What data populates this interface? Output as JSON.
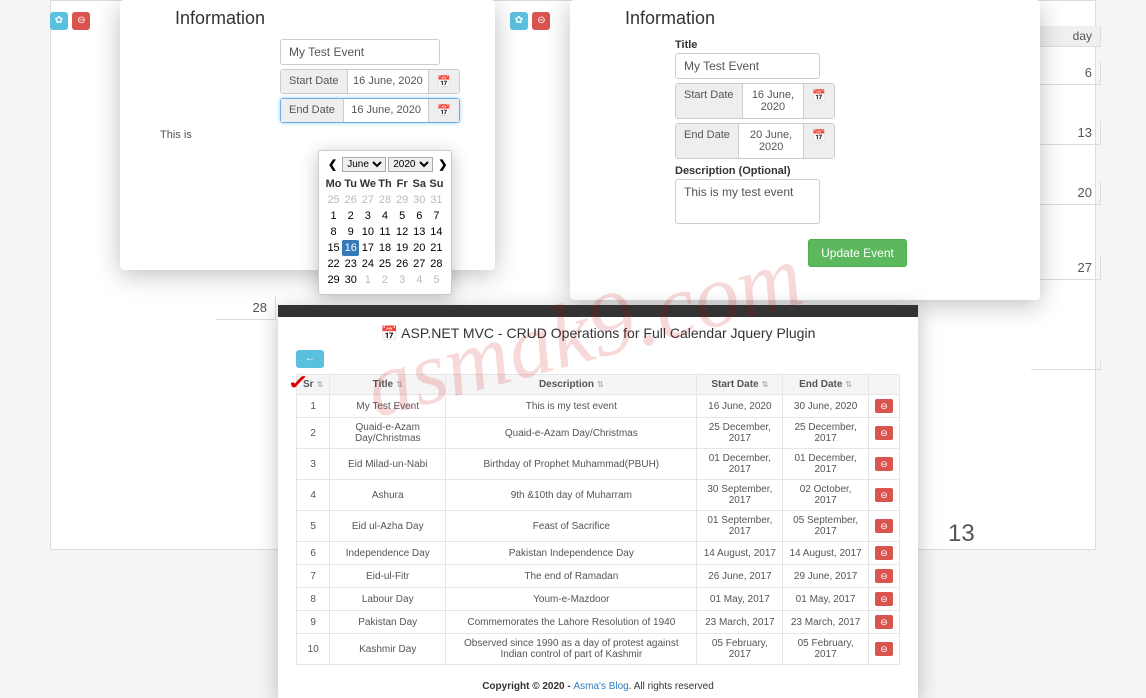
{
  "addModal": {
    "heading": "Information",
    "titleValue": "My Test Event",
    "startLabel": "Start Date",
    "startValue": "16 June, 2020",
    "endLabel": "End Date",
    "endValue": "16 June, 2020",
    "descValue": "This is"
  },
  "updateModal": {
    "heading": "Information",
    "titleLabel": "Title",
    "titleValue": "My Test Event",
    "startLabel": "Start Date",
    "startValue": "16 June, 2020",
    "endLabel": "End Date",
    "endValue": "20 June, 2020",
    "descLabel": "Description (Optional)",
    "descValue": "This is my test event",
    "submit": "Update Event"
  },
  "datepicker": {
    "month": "June",
    "year": "2020",
    "dow": [
      "Mo",
      "Tu",
      "We",
      "Th",
      "Fr",
      "Sa",
      "Su"
    ],
    "prevTail": [
      25,
      26,
      27,
      28,
      29,
      30,
      31
    ],
    "days": [
      1,
      2,
      3,
      4,
      5,
      6,
      7,
      8,
      9,
      10,
      11,
      12,
      13,
      14,
      15,
      16,
      17,
      18,
      19,
      20,
      21,
      22,
      23,
      24,
      25,
      26,
      27,
      28,
      29,
      30
    ],
    "nextHead": [
      1,
      2,
      3,
      4,
      5
    ],
    "selected": 16
  },
  "tableCard": {
    "title": "ASP.NET MVC - CRUD Operations for Full Calendar Jquery Plugin",
    "cols": [
      "Sr",
      "Title",
      "Description",
      "Start Date",
      "End Date"
    ],
    "rows": [
      {
        "sr": 1,
        "title": "My Test Event",
        "desc": "This is my test event",
        "start": "16 June, 2020",
        "end": "30 June, 2020"
      },
      {
        "sr": 2,
        "title": "Quaid-e-Azam Day/Christmas",
        "desc": "Quaid-e-Azam Day/Christmas",
        "start": "25 December, 2017",
        "end": "25 December, 2017"
      },
      {
        "sr": 3,
        "title": "Eid Milad-un-Nabi",
        "desc": "Birthday of Prophet Muhammad(PBUH)",
        "start": "01 December, 2017",
        "end": "01 December, 2017"
      },
      {
        "sr": 4,
        "title": "Ashura",
        "desc": "9th &10th day of Muharram",
        "start": "30 September, 2017",
        "end": "02 October, 2017"
      },
      {
        "sr": 5,
        "title": "Eid ul-Azha Day",
        "desc": "Feast of Sacrifice",
        "start": "01 September, 2017",
        "end": "05 September, 2017"
      },
      {
        "sr": 6,
        "title": "Independence Day",
        "desc": "Pakistan Independence Day",
        "start": "14 August, 2017",
        "end": "14 August, 2017"
      },
      {
        "sr": 7,
        "title": "Eid-ul-Fitr",
        "desc": "The end of Ramadan",
        "start": "26 June, 2017",
        "end": "29 June, 2017"
      },
      {
        "sr": 8,
        "title": "Labour Day",
        "desc": "Youm-e-Mazdoor",
        "start": "01 May, 2017",
        "end": "01 May, 2017"
      },
      {
        "sr": 9,
        "title": "Pakistan Day",
        "desc": "Commemorates the Lahore Resolution of 1940",
        "start": "23 March, 2017",
        "end": "23 March, 2017"
      },
      {
        "sr": 10,
        "title": "Kashmir Day",
        "desc": "Observed since 1990 as a day of protest against Indian control of part of Kashmir",
        "start": "05 February, 2017",
        "end": "05 February, 2017"
      }
    ],
    "footer": {
      "copy": "Copyright © 2020 - ",
      "link": "Asma's Blog",
      "rest": ". All rights reserved"
    }
  },
  "bgCells": {
    "day": "day",
    "d6": "6",
    "d13": "13",
    "d27": "27",
    "d28": "28"
  },
  "bigNum": "13",
  "watermark": "asmak9.com"
}
